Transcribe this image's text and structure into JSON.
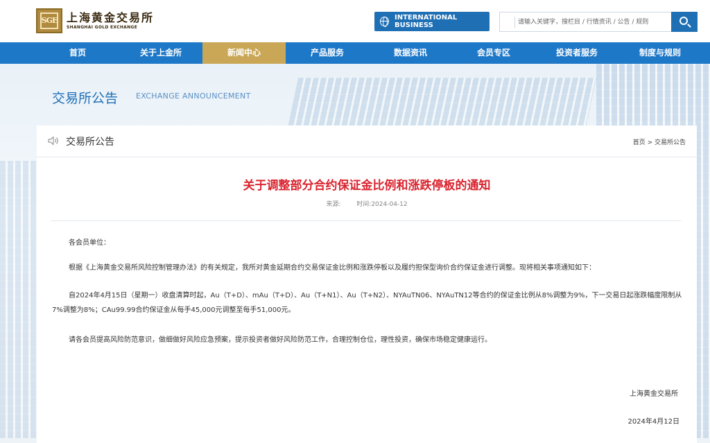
{
  "header": {
    "logo_cn": "上海黄金交易所",
    "logo_en": "SHANGHAI GOLD EXCHANGE",
    "logo_mark": "SGE",
    "intl_button": "INTERNATIONAL BUSINESS",
    "search_placeholder": "请输入关键字，搜栏目 / 行情资讯 / 公告 / 规则"
  },
  "nav": {
    "items": [
      {
        "label": "首页"
      },
      {
        "label": "关于上金所"
      },
      {
        "label": "新闻中心"
      },
      {
        "label": "产品服务"
      },
      {
        "label": "数据资讯"
      },
      {
        "label": "会员专区"
      },
      {
        "label": "投资者服务"
      },
      {
        "label": "制度与规则"
      }
    ],
    "active_index": 2
  },
  "banner": {
    "title": "交易所公告",
    "title_en": "EXCHANGE ANNOUNCEMENT"
  },
  "card": {
    "title": "交易所公告",
    "breadcrumb": "首页 > 交易所公告"
  },
  "article": {
    "title": "关于调整部分合约保证金比例和涨跌停板的通知",
    "source_label": "来源:",
    "time_label": "时间:2024-04-12",
    "salutation": "各会员单位：",
    "para1": "根据《上海黄金交易所风险控制管理办法》的有关规定，我所对黄金延期合约交易保证金比例和涨跌停板以及履约担保型询价合约保证金进行调整。现将相关事项通知如下：",
    "para2": "自2024年4月15日（星期一）收盘清算时起，Au（T+D）、mAu（T+D）、Au（T+N1）、Au（T+N2）、NYAuTN06、NYAuTN12等合约的保证金比例从8%调整为9%，下一交易日起涨跌幅度限制从7%调整为8%；CAu99.99合约保证金从每手45,000元调整至每手51,000元。",
    "para3": "请各会员提高风险防范意识，做细做好风险应急预案，提示投资者做好风险防范工作，合理控制仓位，理性投资，确保市场稳定健康运行。",
    "signature": "上海黄金交易所",
    "date": "2024年4月12日"
  },
  "colors": {
    "primary_blue": "#1e78c8",
    "active_gold": "#c9a757",
    "title_red": "#d9232e"
  }
}
